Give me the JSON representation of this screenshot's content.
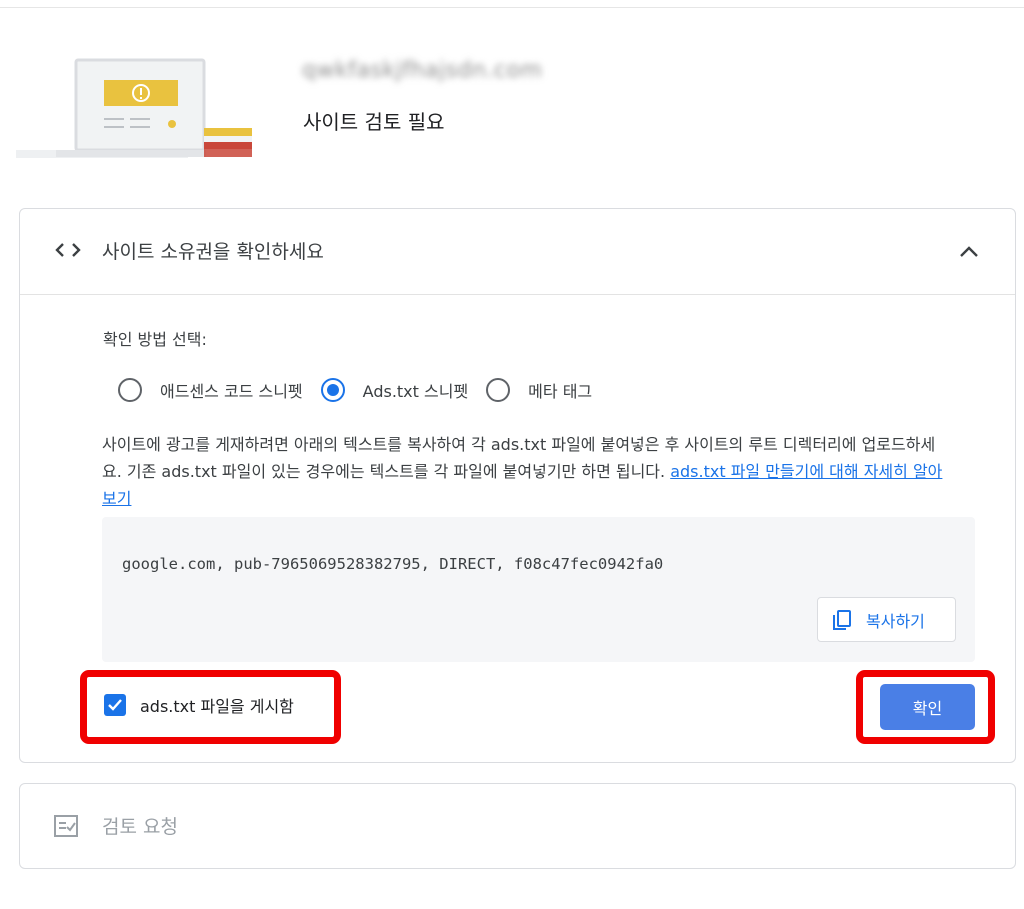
{
  "site": {
    "url": "qwkfaskjfhajsdn.com",
    "status": "사이트 검토 필요"
  },
  "ownership": {
    "title": "사이트 소유권을 확인하세요",
    "method_label": "확인 방법 선택:",
    "options": [
      {
        "label": "애드센스 코드 스니펫",
        "selected": false
      },
      {
        "label": "Ads.txt 스니펫",
        "selected": true
      },
      {
        "label": "메타 태그",
        "selected": false
      }
    ],
    "description": "사이트에 광고를 게재하려면 아래의 텍스트를 복사하여 각 ads.txt 파일에 붙여넣은 후 사이트의 루트 디렉터리에 업로드하세요. 기존 ads.txt 파일이 있는 경우에는 텍스트를 각 파일에 붙여넣기만 하면 됩니다. ",
    "learn_more_link": "ads.txt 파일 만들기에 대해 자세히 알아보기",
    "snippet": "google.com, pub-7965069528382795, DIRECT, f08c47fec0942fa0",
    "copy_label": "복사하기",
    "checkbox_label": "ads.txt 파일을 게시함",
    "checkbox_checked": true,
    "confirm_label": "확인"
  },
  "review": {
    "title": "검토 요청"
  },
  "colors": {
    "accent": "#1a73e8",
    "confirm_button": "#4a7fe6",
    "highlight": "#f00000",
    "illustration_yellow": "#e9c23f",
    "illustration_red": "#c9473a"
  },
  "icons": [
    "code-icon",
    "chevron-up-icon",
    "copy-icon",
    "check-icon",
    "review-checklist-icon"
  ]
}
